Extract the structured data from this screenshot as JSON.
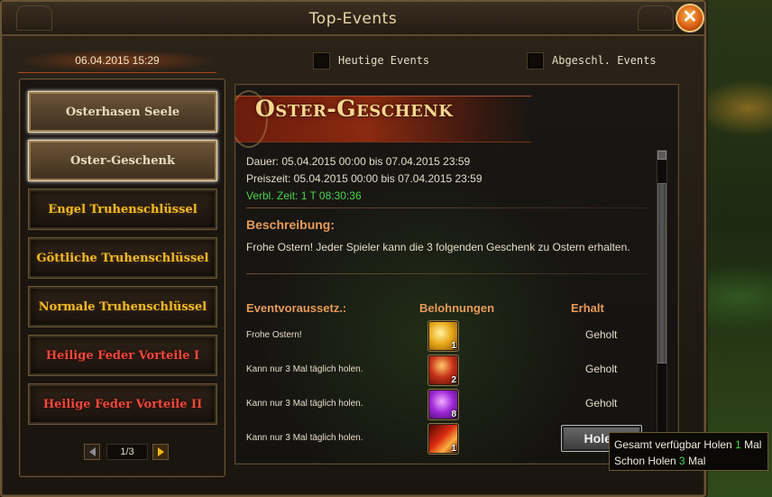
{
  "window": {
    "title": "Top-Events",
    "close_label": "✕"
  },
  "topbar": {
    "datetime": "06.04.2015 15:29",
    "today_events_label": "Heutige Events",
    "finished_events_label": "Abgeschl. Events"
  },
  "sidebar": {
    "items": [
      {
        "label": "Osterhasen Seele",
        "style": "white",
        "selected": true
      },
      {
        "label": "Oster-Geschenk",
        "style": "white",
        "selected": true
      },
      {
        "label": "Engel Truhenschlüssel",
        "style": "gold",
        "selected": false
      },
      {
        "label": "Göttliche Truhenschlüssel",
        "style": "gold",
        "selected": false
      },
      {
        "label": "Normale Truhenschlüssel",
        "style": "gold",
        "selected": false
      },
      {
        "label": "Heilige Feder Vorteile I",
        "style": "red",
        "selected": false
      },
      {
        "label": "Heilige Feder Vorteile II",
        "style": "red",
        "selected": false
      }
    ],
    "pager": "1/3"
  },
  "event": {
    "title": "Oster-Geschenk",
    "duration": "Dauer: 05.04.2015 00:00 bis 07.04.2015 23:59",
    "prize_time": "Preiszeit: 05.04.2015 00:00 bis 07.04.2015 23:59",
    "remaining": "Verbl. Zeit: 1 T  08:30:36",
    "description_heading": "Beschreibung:",
    "description": "Frohe Ostern! Jeder Spieler kann die 3 folgenden Geschenk zu Ostern erhalten.",
    "col_requirement": "Eventvoraussetz.:",
    "col_rewards": "Belohnungen",
    "col_received": "Erhalt",
    "rows": [
      {
        "requirement": "Frohe Ostern!",
        "reward_icon": "golden-key-icon",
        "count": "1",
        "status": "Geholt"
      },
      {
        "requirement": "Kann nur 3 Mal täglich holen.",
        "reward_icon": "red-scepter-icon",
        "count": "2",
        "status": "Geholt"
      },
      {
        "requirement": "Kann nur 3 Mal täglich holen.",
        "reward_icon": "purple-gem-icon",
        "count": "8",
        "status": "Geholt"
      },
      {
        "requirement": "Kann nur 3 Mal täglich holen.",
        "reward_icon": "red-feather-icon",
        "count": "1",
        "status": "Holen"
      }
    ]
  },
  "tooltip": {
    "line1_prefix": "Gesamt verfügbar  Holen ",
    "line1_value": "1",
    "line1_suffix": " Mal",
    "line2_prefix": "Schon Holen ",
    "line2_value": "3",
    "line2_suffix": " Mal"
  },
  "colors": {
    "accent_orange": "#e89a58",
    "title_gold": "#f6d891",
    "remaining_green": "#4ad64a"
  }
}
